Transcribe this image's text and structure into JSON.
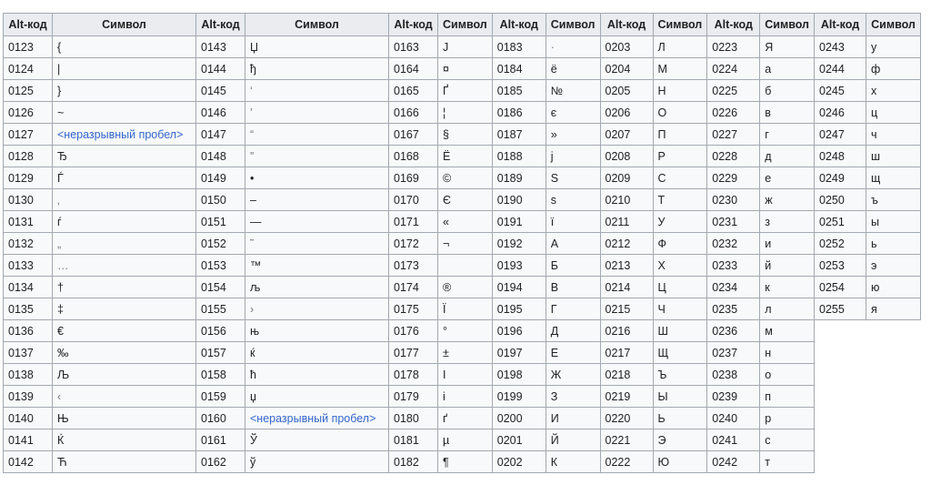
{
  "table": {
    "headers": [
      "Alt-код",
      "Символ",
      "Alt-код",
      "Символ",
      "Alt-код",
      "Символ",
      "Alt-код",
      "Символ",
      "Alt-код",
      "Символ",
      "Alt-код",
      "Символ",
      "Alt-код",
      "Символ"
    ],
    "colors": {
      "header_bg": "#eaecf0",
      "cell_bg": "#f8f9fa",
      "border": "#a2a9b1",
      "link": "#3366cc"
    },
    "columns": [
      [
        {
          "code": "0123",
          "sym": "{"
        },
        {
          "code": "0124",
          "sym": "|"
        },
        {
          "code": "0125",
          "sym": "}"
        },
        {
          "code": "0126",
          "sym": "~"
        },
        {
          "code": "0127",
          "sym": "<неразрывный пробел>",
          "link": true
        },
        {
          "code": "0128",
          "sym": "Ђ"
        },
        {
          "code": "0129",
          "sym": "Ѓ"
        },
        {
          "code": "0130",
          "sym": "‚"
        },
        {
          "code": "0131",
          "sym": "ѓ"
        },
        {
          "code": "0132",
          "sym": "„"
        },
        {
          "code": "0133",
          "sym": "…"
        },
        {
          "code": "0134",
          "sym": "†"
        },
        {
          "code": "0135",
          "sym": "‡"
        },
        {
          "code": "0136",
          "sym": "€"
        },
        {
          "code": "0137",
          "sym": "‰"
        },
        {
          "code": "0138",
          "sym": "Љ"
        },
        {
          "code": "0139",
          "sym": "‹"
        },
        {
          "code": "0140",
          "sym": "Њ"
        },
        {
          "code": "0141",
          "sym": "Ќ"
        },
        {
          "code": "0142",
          "sym": "Ћ"
        }
      ],
      [
        {
          "code": "0143",
          "sym": "Џ"
        },
        {
          "code": "0144",
          "sym": "ђ"
        },
        {
          "code": "0145",
          "sym": "‘"
        },
        {
          "code": "0146",
          "sym": "’"
        },
        {
          "code": "0147",
          "sym": "“"
        },
        {
          "code": "0148",
          "sym": "”"
        },
        {
          "code": "0149",
          "sym": "•"
        },
        {
          "code": "0150",
          "sym": "–"
        },
        {
          "code": "0151",
          "sym": "—"
        },
        {
          "code": "0152",
          "sym": "˜"
        },
        {
          "code": "0153",
          "sym": "™"
        },
        {
          "code": "0154",
          "sym": "љ"
        },
        {
          "code": "0155",
          "sym": "›"
        },
        {
          "code": "0156",
          "sym": "њ"
        },
        {
          "code": "0157",
          "sym": "ќ"
        },
        {
          "code": "0158",
          "sym": "ћ"
        },
        {
          "code": "0159",
          "sym": "џ"
        },
        {
          "code": "0160",
          "sym": "<неразрывный пробел>",
          "link": true
        },
        {
          "code": "0161",
          "sym": "Ў"
        },
        {
          "code": "0162",
          "sym": "ў"
        }
      ],
      [
        {
          "code": "0163",
          "sym": "Ј"
        },
        {
          "code": "0164",
          "sym": "¤"
        },
        {
          "code": "0165",
          "sym": "Ґ"
        },
        {
          "code": "0166",
          "sym": "¦"
        },
        {
          "code": "0167",
          "sym": "§"
        },
        {
          "code": "0168",
          "sym": "Ё"
        },
        {
          "code": "0169",
          "sym": "©"
        },
        {
          "code": "0170",
          "sym": "Є"
        },
        {
          "code": "0171",
          "sym": "«"
        },
        {
          "code": "0172",
          "sym": "¬"
        },
        {
          "code": "0173",
          "sym": ""
        },
        {
          "code": "0174",
          "sym": "®"
        },
        {
          "code": "0175",
          "sym": "Ї"
        },
        {
          "code": "0176",
          "sym": "°"
        },
        {
          "code": "0177",
          "sym": "±"
        },
        {
          "code": "0178",
          "sym": "І"
        },
        {
          "code": "0179",
          "sym": "і"
        },
        {
          "code": "0180",
          "sym": "ґ"
        },
        {
          "code": "0181",
          "sym": "µ"
        },
        {
          "code": "0182",
          "sym": "¶"
        }
      ],
      [
        {
          "code": "0183",
          "sym": "·"
        },
        {
          "code": "0184",
          "sym": "ё"
        },
        {
          "code": "0185",
          "sym": "№"
        },
        {
          "code": "0186",
          "sym": "є"
        },
        {
          "code": "0187",
          "sym": "»"
        },
        {
          "code": "0188",
          "sym": "ј"
        },
        {
          "code": "0189",
          "sym": "Ѕ"
        },
        {
          "code": "0190",
          "sym": "ѕ"
        },
        {
          "code": "0191",
          "sym": "ї"
        },
        {
          "code": "0192",
          "sym": "А"
        },
        {
          "code": "0193",
          "sym": "Б"
        },
        {
          "code": "0194",
          "sym": "В"
        },
        {
          "code": "0195",
          "sym": "Г"
        },
        {
          "code": "0196",
          "sym": "Д"
        },
        {
          "code": "0197",
          "sym": "Е"
        },
        {
          "code": "0198",
          "sym": "Ж"
        },
        {
          "code": "0199",
          "sym": "З"
        },
        {
          "code": "0200",
          "sym": "И"
        },
        {
          "code": "0201",
          "sym": "Й"
        },
        {
          "code": "0202",
          "sym": "К"
        }
      ],
      [
        {
          "code": "0203",
          "sym": "Л"
        },
        {
          "code": "0204",
          "sym": "М"
        },
        {
          "code": "0205",
          "sym": "Н"
        },
        {
          "code": "0206",
          "sym": "О"
        },
        {
          "code": "0207",
          "sym": "П"
        },
        {
          "code": "0208",
          "sym": "Р"
        },
        {
          "code": "0209",
          "sym": "С"
        },
        {
          "code": "0210",
          "sym": "Т"
        },
        {
          "code": "0211",
          "sym": "У"
        },
        {
          "code": "0212",
          "sym": "Ф"
        },
        {
          "code": "0213",
          "sym": "Х"
        },
        {
          "code": "0214",
          "sym": "Ц"
        },
        {
          "code": "0215",
          "sym": "Ч"
        },
        {
          "code": "0216",
          "sym": "Ш"
        },
        {
          "code": "0217",
          "sym": "Щ"
        },
        {
          "code": "0218",
          "sym": "Ъ"
        },
        {
          "code": "0219",
          "sym": "Ы"
        },
        {
          "code": "0220",
          "sym": "Ь"
        },
        {
          "code": "0221",
          "sym": "Э"
        },
        {
          "code": "0222",
          "sym": "Ю"
        }
      ],
      [
        {
          "code": "0223",
          "sym": "Я"
        },
        {
          "code": "0224",
          "sym": "а"
        },
        {
          "code": "0225",
          "sym": "б"
        },
        {
          "code": "0226",
          "sym": "в"
        },
        {
          "code": "0227",
          "sym": "г"
        },
        {
          "code": "0228",
          "sym": "д"
        },
        {
          "code": "0229",
          "sym": "е"
        },
        {
          "code": "0230",
          "sym": "ж"
        },
        {
          "code": "0231",
          "sym": "з"
        },
        {
          "code": "0232",
          "sym": "и"
        },
        {
          "code": "0233",
          "sym": "й"
        },
        {
          "code": "0234",
          "sym": "к"
        },
        {
          "code": "0235",
          "sym": "л"
        },
        {
          "code": "0236",
          "sym": "м"
        },
        {
          "code": "0237",
          "sym": "н"
        },
        {
          "code": "0238",
          "sym": "о"
        },
        {
          "code": "0239",
          "sym": "п"
        },
        {
          "code": "0240",
          "sym": "р"
        },
        {
          "code": "0241",
          "sym": "с"
        },
        {
          "code": "0242",
          "sym": "т"
        }
      ],
      [
        {
          "code": "0243",
          "sym": "у"
        },
        {
          "code": "0244",
          "sym": "ф"
        },
        {
          "code": "0245",
          "sym": "х"
        },
        {
          "code": "0246",
          "sym": "ц"
        },
        {
          "code": "0247",
          "sym": "ч"
        },
        {
          "code": "0248",
          "sym": "ш"
        },
        {
          "code": "0249",
          "sym": "щ"
        },
        {
          "code": "0250",
          "sym": "ъ"
        },
        {
          "code": "0251",
          "sym": "ы"
        },
        {
          "code": "0252",
          "sym": "ь"
        },
        {
          "code": "0253",
          "sym": "э"
        },
        {
          "code": "0254",
          "sym": "ю"
        },
        {
          "code": "0255",
          "sym": "я"
        }
      ]
    ]
  }
}
